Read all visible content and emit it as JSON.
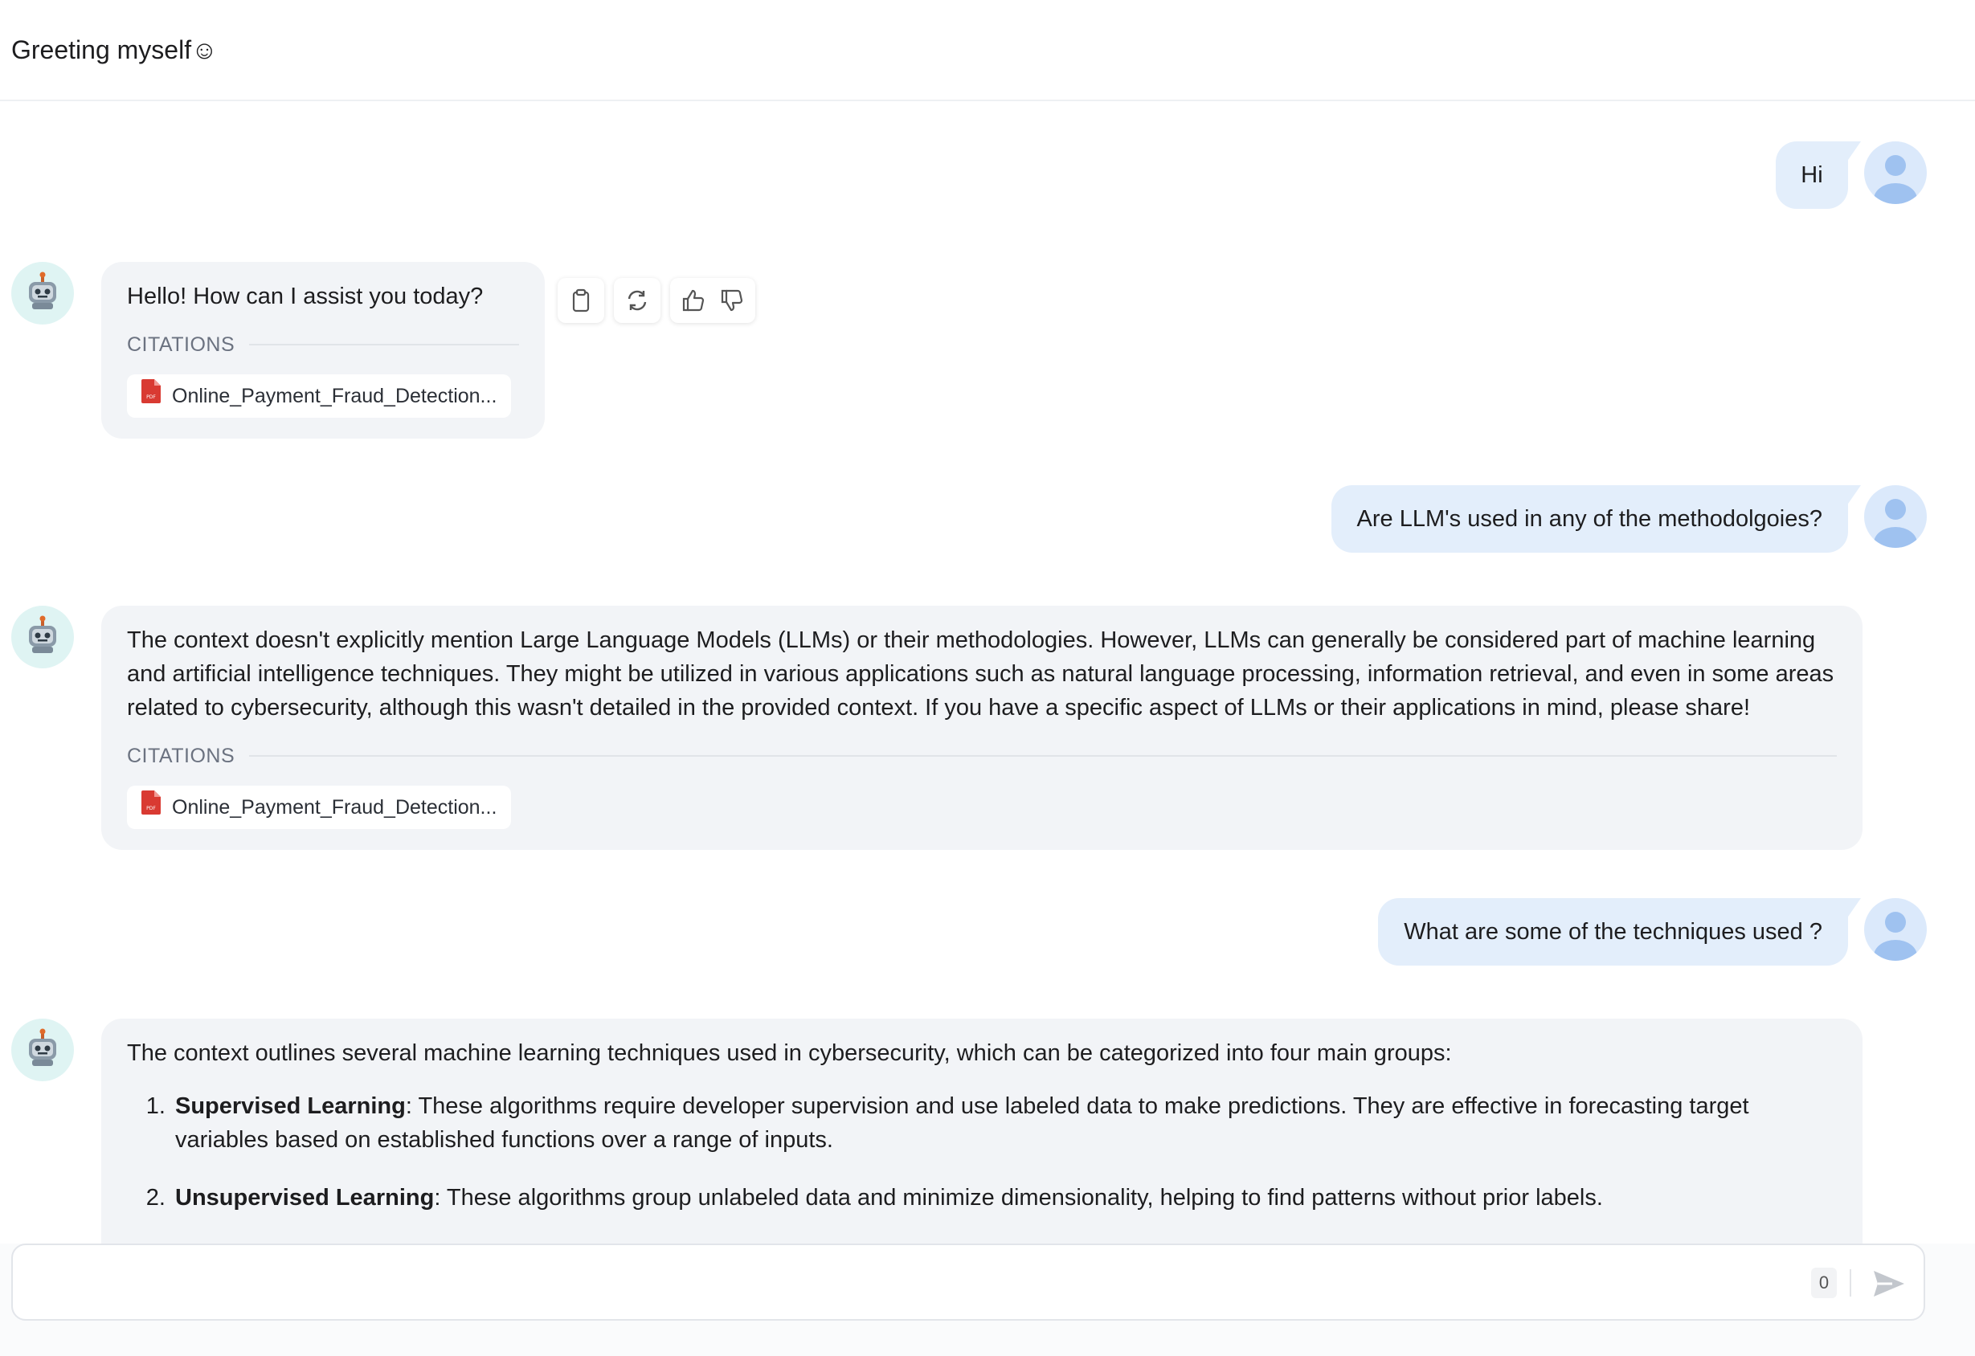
{
  "header": {
    "title": "Greeting myself☺"
  },
  "messages": {
    "user1": "Hi",
    "bot1": {
      "text": "Hello! How can I assist you today?",
      "citations_label": "CITATIONS",
      "citation": "Online_Payment_Fraud_Detection..."
    },
    "user2": "Are LLM's used in any of the methodolgoies?",
    "bot2": {
      "text": "The context doesn't explicitly mention Large Language Models (LLMs) or their methodologies. However, LLMs can generally be considered part of machine learning and artificial intelligence techniques. They might be utilized in various applications such as natural language processing, information retrieval, and even in some areas related to cybersecurity, although this wasn't detailed in the provided context. If you have a specific aspect of LLMs or their applications in mind, please share!",
      "citations_label": "CITATIONS",
      "citation": "Online_Payment_Fraud_Detection..."
    },
    "user3": "What are some of the techniques used ?",
    "bot3": {
      "intro": "The context outlines several machine learning techniques used in cybersecurity, which can be categorized into four main groups:",
      "items": [
        {
          "term": "Supervised Learning",
          "desc": ": These algorithms require developer supervision and use labeled data to make predictions. They are effective in forecasting target variables based on established functions over a range of inputs."
        },
        {
          "term": "Unsupervised Learning",
          "desc": ": These algorithms group unlabeled data and minimize dimensionality, helping to find patterns without prior labels."
        }
      ]
    }
  },
  "actions": [
    "copy-icon",
    "regenerate-icon",
    "thumbs-up-icon",
    "thumbs-down-icon"
  ],
  "composer": {
    "value": "",
    "placeholder": "",
    "char_count": "0"
  },
  "colors": {
    "user_bubble": "#e3eefb",
    "bot_bubble": "#f2f4f7",
    "user_avatar": "#dbe9fb",
    "bot_avatar": "#dff4f3",
    "pdf_icon": "#d93a32"
  }
}
